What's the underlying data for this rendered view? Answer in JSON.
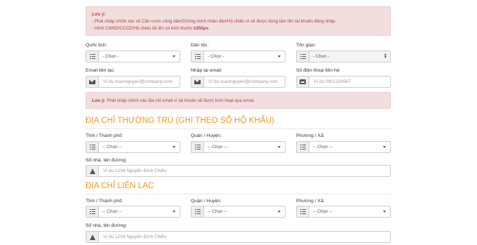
{
  "alert_top": {
    "title": "Lưu ý:",
    "line1": "- Phải nhập chính xác số Căn cước công dân/Chứng minh nhân dân/Hộ chiếu vì sẽ được dùng làm tên tài khoản đăng nhập.",
    "line2_prefix": "- Hình CMND/CCCD/Hộ chiếu tải lên có kích thước ",
    "line2_bold": "≥350px",
    "line2_suffix": "."
  },
  "row1": {
    "nationality_label": "Quốc tịch:",
    "nationality_value": "- Chọn -",
    "ethnicity_label": "Dân tộc:",
    "ethnicity_value": "- Chọn -",
    "religion_label": "Tôn giáo:",
    "religion_value": "- Chọn -"
  },
  "row2": {
    "email_label": "Email liên lạc:",
    "email_placeholder": "Ví dụ xuannguyen@company.com",
    "email_confirm_label": "Nhập lại email:",
    "email_confirm_placeholder": "Ví dụ xuannguyen@company.com",
    "phone_label": "Số điện thoại liên hệ:",
    "phone_placeholder": "Ví dụ 0901234567"
  },
  "alert_email": {
    "bold": "Lưu ý:",
    "text": " Phải nhập chính xác địa chỉ email vì tài khoản sẽ được kích hoạt qua email."
  },
  "permanent": {
    "heading": "ĐỊA CHỈ THƯỜNG TRÚ (GHI THEO SỔ HỘ KHẨU)",
    "province_label": "Tỉnh / Thành phố:",
    "province_value": "-- Chọn --",
    "district_label": "Quận / Huyện:",
    "district_value": "-- Chọn --",
    "ward_label": "Phường / Xã:",
    "ward_value": "-- Chọn --",
    "street_label": "Số nhà, tên đường:",
    "street_placeholder": "Ví dụ 1234 Nguyễn Đình Chiểu"
  },
  "contact": {
    "heading": "ĐỊA CHỈ LIÊN LẠC",
    "province_label": "Tỉnh / Thành phố:",
    "province_value": "-- Chọn --",
    "district_label": "Quận / Huyện:",
    "district_value": "-- Chọn --",
    "ward_label": "Phường / Xã:",
    "ward_value": "-- Chọn --",
    "street_label": "Số nhà, tên đường:",
    "street_placeholder": "Ví dụ 1234 Nguyễn Đình Chiểu"
  },
  "colors": {
    "accent_heading": "#f7941d",
    "alert_bg": "#f2dede",
    "alert_text": "#a94442"
  }
}
